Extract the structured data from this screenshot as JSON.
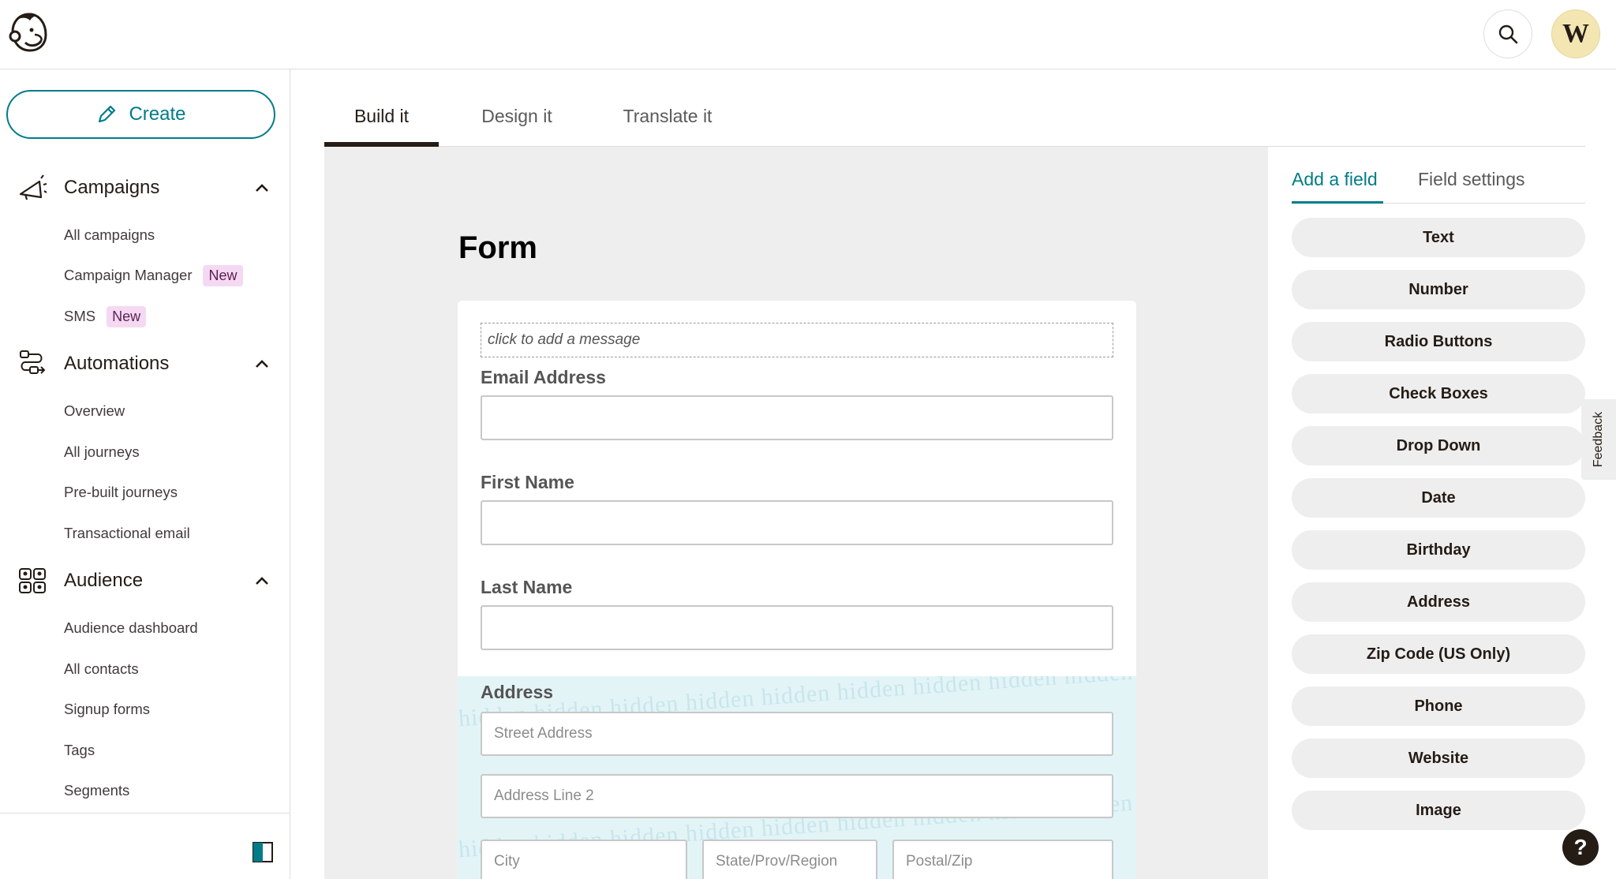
{
  "sidebar": {
    "create_label": "Create",
    "sections": [
      {
        "label": "Campaigns",
        "icon": "megaphone-icon",
        "items": [
          {
            "label": "All campaigns"
          },
          {
            "label": "Campaign Manager",
            "badge": "New"
          },
          {
            "label": "SMS",
            "badge": "New"
          }
        ]
      },
      {
        "label": "Automations",
        "icon": "automation-flow-icon",
        "items": [
          {
            "label": "Overview"
          },
          {
            "label": "All journeys"
          },
          {
            "label": "Pre-built journeys"
          },
          {
            "label": "Transactional email"
          }
        ]
      },
      {
        "label": "Audience",
        "icon": "audience-icon",
        "items": [
          {
            "label": "Audience dashboard"
          },
          {
            "label": "All contacts"
          },
          {
            "label": "Signup forms"
          },
          {
            "label": "Tags"
          },
          {
            "label": "Segments"
          }
        ]
      }
    ]
  },
  "header": {
    "avatar_initial": "W"
  },
  "tabs": [
    {
      "label": "Build it",
      "active": true
    },
    {
      "label": "Design it"
    },
    {
      "label": "Translate it"
    }
  ],
  "form": {
    "title": "Form",
    "message_placeholder": "click to add a message",
    "fields": [
      {
        "label": "Email Address"
      },
      {
        "label": "First Name"
      },
      {
        "label": "Last Name"
      }
    ],
    "address": {
      "label": "Address",
      "watermark": "hidden",
      "street": "Street Address",
      "line2": "Address Line 2",
      "city": "City",
      "state": "State/Prov/Region",
      "zip": "Postal/Zip"
    }
  },
  "panel": {
    "tabs": [
      {
        "label": "Add a field",
        "active": true
      },
      {
        "label": "Field settings"
      }
    ],
    "fields": [
      "Text",
      "Number",
      "Radio Buttons",
      "Check Boxes",
      "Drop Down",
      "Date",
      "Birthday",
      "Address",
      "Zip Code (US Only)",
      "Phone",
      "Website",
      "Image"
    ]
  },
  "feedback_label": "Feedback",
  "help_label": "?",
  "colors": {
    "accent": "#007c89",
    "badge": "#f5d9f2",
    "hidden_zone": "#e3f4f7"
  }
}
